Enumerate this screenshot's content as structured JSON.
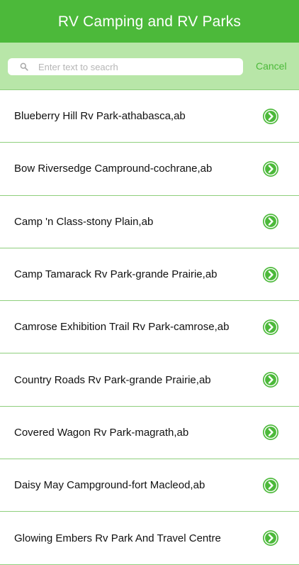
{
  "nav": {
    "title": "RV Camping and RV Parks"
  },
  "search": {
    "placeholder": "Enter text to seacrh",
    "value": "",
    "cancel_label": "Cancel"
  },
  "colors": {
    "brand_green": "#4cb93a",
    "search_bar_bg": "#b8e6a8",
    "divider": "#8fcf7d"
  },
  "icons": {
    "search": "magnifier-icon",
    "row_action": "chevron-right-circle-icon"
  },
  "parks": [
    {
      "label": "Blueberry Hill Rv Park-athabasca,ab"
    },
    {
      "label": "Bow Riversedge Campround-cochrane,ab"
    },
    {
      "label": "Camp 'n Class-stony Plain,ab"
    },
    {
      "label": "Camp Tamarack Rv Park-grande Prairie,ab"
    },
    {
      "label": "Camrose Exhibition Trail Rv Park-camrose,ab"
    },
    {
      "label": "Country Roads Rv Park-grande Prairie,ab"
    },
    {
      "label": "Covered Wagon Rv Park-magrath,ab"
    },
    {
      "label": "Daisy May Campground-fort Macleod,ab"
    },
    {
      "label": "Glowing Embers Rv Park And Travel Centre"
    }
  ]
}
